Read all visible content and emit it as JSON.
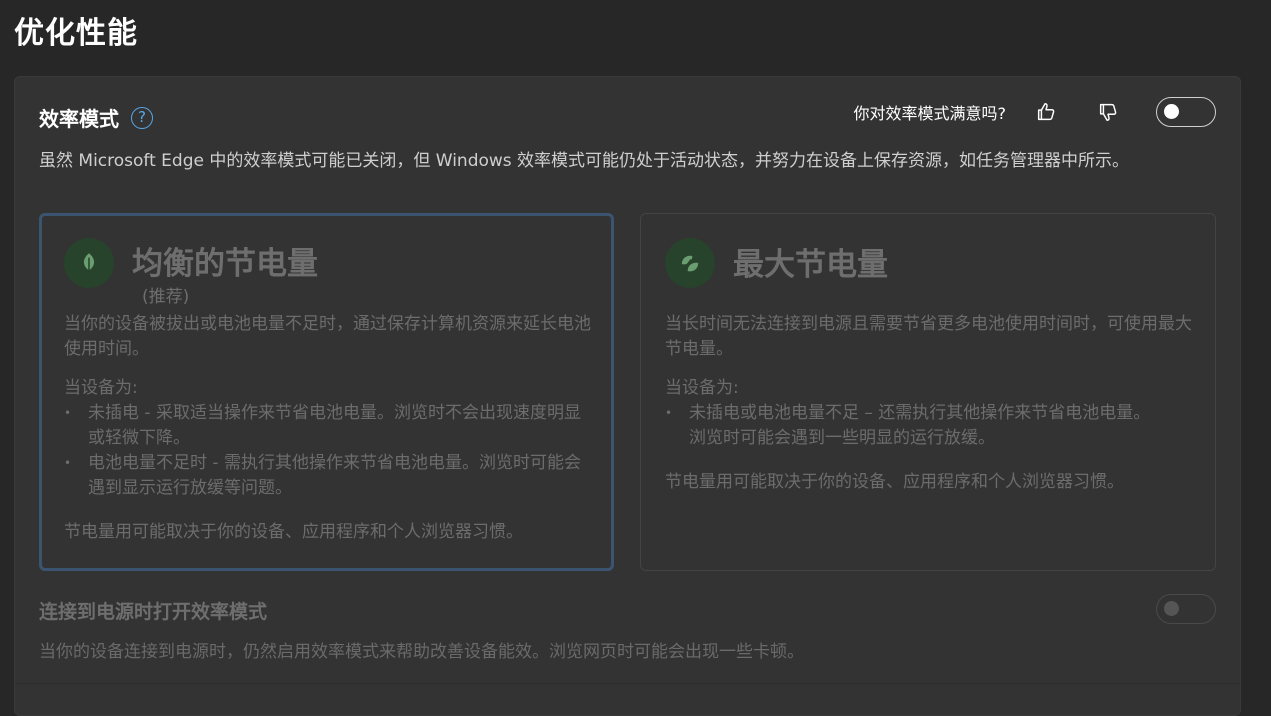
{
  "page": {
    "title": "优化性能"
  },
  "efficiency": {
    "title": "效率模式",
    "help_icon": "?",
    "feedback_question": "你对效率模式满意吗?",
    "toggle_on": false,
    "description": "虽然 Microsoft Edge 中的效率模式可能已关闭，但 Windows 效率模式可能仍处于活动状态，并努力在设备上保存资源，如任务管理器中所示。"
  },
  "options": [
    {
      "title": "均衡的节电量",
      "subtitle": "(推荐)",
      "description": "当你的设备被拔出或电池电量不足时，通过保存计算机资源来延长电池使用时间。",
      "when_label": "当设备为:",
      "bullets": [
        "未插电 - 采取适当操作来节省电池电量。浏览时不会出现速度明显或轻微下降。",
        "电池电量不足时 - 需执行其他操作来节省电池电量。浏览时可能会遇到显示运行放缓等问题。"
      ],
      "footnote": "节电量用可能取决于你的设备、应用程序和个人浏览器习惯。",
      "selected": true
    },
    {
      "title": "最大节电量",
      "description": "当长时间无法连接到电源且需要节省更多电池使用时间时，可使用最大节电量。",
      "when_label": "当设备为:",
      "bullets": [
        "未插电或电池电量不足 – 还需执行其他操作来节省电池电量。浏览时可能会遇到一些明显的运行放缓。"
      ],
      "footnote": "节电量用可能取决于你的设备、应用程序和个人浏览器习惯。",
      "selected": false
    }
  ],
  "power": {
    "title": "连接到电源时打开效率模式",
    "description": "当你的设备连接到电源时，仍然启用效率模式来帮助改善设备能效。浏览网页时可能会出现一些卡顿。",
    "toggle_on": false
  },
  "icons": {
    "help": "question-circle-icon",
    "like": "thumbs-up-icon",
    "dislike": "thumbs-down-icon",
    "balanced": "leaf-icon",
    "maximum": "leaves-icon"
  },
  "colors": {
    "accent": "#5aa7e5",
    "icon_bg": "#27432b",
    "icon_fg": "#6a9d6f",
    "selected_border": "#3b5470"
  }
}
